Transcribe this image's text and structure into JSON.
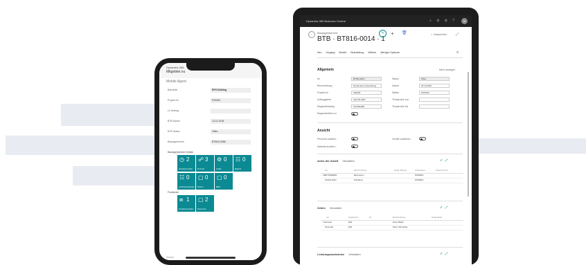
{
  "phone": {
    "app_name": "Dynamics 365",
    "page_title": "Mitgebtei.nu",
    "tab_label": "Mobile Agent",
    "fields": [
      {
        "label": "Baustelle",
        "value": "EFH Döbling",
        "bold": true
      },
      {
        "label": "Projekt-Nr.",
        "value": "P00090",
        "bold": false
      },
      {
        "label": "LV Auftrag",
        "value": "",
        "bold": false
      },
      {
        "label": "BTB Datum",
        "value": "13.11.2018",
        "bold": false
      },
      {
        "label": "BTB Status",
        "value": "Offen",
        "bold": false
      },
      {
        "label": "Bautagebericht",
        "value": "BTB16-0086",
        "bold": false
      }
    ],
    "section1": "Bautagesbericht Details",
    "tiles_row1": [
      {
        "icon": "◷",
        "count": "2",
        "label": "Arbeitszeit erfasst"
      },
      {
        "icon": "☍",
        "count": "3",
        "label": "Personal"
      },
      {
        "icon": "⚙",
        "count": "0",
        "label": "Geräte"
      },
      {
        "icon": "☷",
        "count": "0",
        "label": "Material"
      }
    ],
    "tiles_row2": [
      {
        "icon": "☷",
        "count": "0",
        "label": "Leistungsmeldungen"
      },
      {
        "icon": "▢",
        "count": "0",
        "label": "Notizen"
      },
      {
        "icon": "▢",
        "count": "0",
        "label": "Bilder"
      }
    ],
    "section2": "Positionen",
    "tiles_row3": [
      {
        "icon": "⧈",
        "count": "1",
        "label": "Fotodokumentation"
      },
      {
        "icon": "▢",
        "count": "2",
        "label": "Dokumente"
      }
    ],
    "footer_label": "Zurück"
  },
  "tablet": {
    "app_name": "Dynamics 365 Business Central",
    "topbar_icons": "⌕ ⚙ ⚙ ?",
    "avatar": "M",
    "breadcrumb": "Bautagesbericht",
    "title": "BTB · BT816-0014 · 1",
    "saved_label": "✓ Gespeichert",
    "menu": [
      "Neu",
      "Vorgang",
      "Bericht",
      "Bearbeitung",
      "Weitere",
      "Weniger Optionen"
    ],
    "general": {
      "title": "Allgemein",
      "show_more": "Mehr anzeigen",
      "left": [
        {
          "label": "Nr.",
          "value": "BT816-0014",
          "grey": true
        },
        {
          "label": "Beschreibung",
          "value": "Rundentest Verhandlung",
          "grey": false
        },
        {
          "label": "Projekt-Nr.",
          "value": "P00090",
          "grey": false
        },
        {
          "label": "Auftraggeber",
          "value": "AHUTE-0007",
          "grey": false
        },
        {
          "label": "Regelarbeitstag",
          "value": "STANDARD",
          "grey": false
        },
        {
          "label": "Regenarbeiten zu",
          "value": "",
          "grey": false
        }
      ],
      "right": [
        {
          "label": "Status",
          "value": "Offen",
          "grey": true
        },
        {
          "label": "Datum",
          "value": "25.10.2020",
          "grey": false
        },
        {
          "label": "Wetter",
          "value": "SONNIG",
          "grey": false
        },
        {
          "label": "Temperatur von",
          "value": "",
          "grey": false
        },
        {
          "label": "Temperatur bis",
          "value": "",
          "grey": false
        }
      ]
    },
    "overview": {
      "title": "Ansicht",
      "toggles": [
        "Personal ausblen...",
        "Geräte ausblend...",
        "Material ausblen..."
      ]
    },
    "types": {
      "title": "Arten der Arbeit",
      "manage": "Verwalten",
      "headers": [
        "Art",
        "Beschreibung",
        "Regie-Belegn",
        "Arbeitsaum...",
        "Zusatz Druck"
      ],
      "rows": [
        [
          "→ BETONIEREN",
          "Betonieren",
          "",
          "NORMAL",
          ""
        ],
        [
          "SCHALUNG",
          "Schalung",
          "",
          "NORMAL",
          ""
        ]
      ]
    },
    "times": {
      "title": "Zeiten",
      "manage": "Verwalten",
      "headers": [
        "Art",
        "Katalog-Nr.",
        "Nr.",
        "Beschreibung",
        "Regiehelfer"
      ],
      "rows": [
        [
          "→ Personal",
          "E04",
          "",
          "Hans Müller",
          ""
        ],
        [
          "Personal",
          "E04",
          "",
          "Peter Schneider",
          ""
        ]
      ]
    },
    "performance": {
      "title": "Leistungsnachweise",
      "manage": "Verwalten"
    }
  }
}
